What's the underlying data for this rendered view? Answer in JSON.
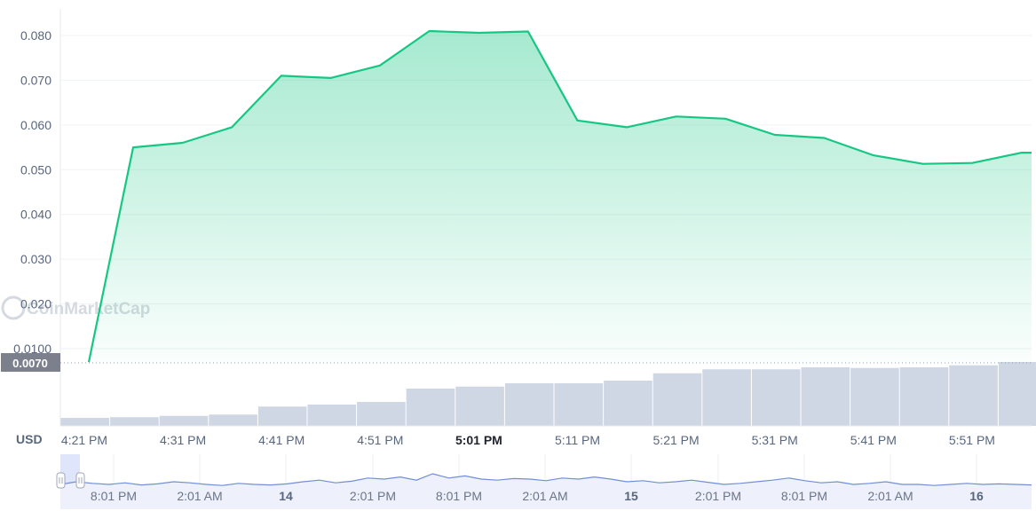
{
  "watermark": "CoinMarketCap",
  "currency_label": "USD",
  "current_price_label": "0.0070",
  "colors": {
    "line": "#16c784",
    "area_top": "#16c784",
    "volume_bar": "#cfd6e4",
    "navigator_line": "#6f8fd8",
    "navigator_fill": "#eef1fc",
    "price_badge": "#7c808c",
    "axis_text": "#58667e",
    "grid": "#eff2f5"
  },
  "chart_data": {
    "type": "area",
    "ylim": [
      0,
      0.085
    ],
    "y_ticks": [
      "0.0100",
      "0.020",
      "0.030",
      "0.040",
      "0.050",
      "0.060",
      "0.070",
      "0.080"
    ],
    "x_ticks": [
      "4:21 PM",
      "4:31 PM",
      "4:41 PM",
      "4:51 PM",
      "5:01 PM",
      "5:11 PM",
      "5:21 PM",
      "5:31 PM",
      "5:41 PM",
      "5:51 PM"
    ],
    "x_ticks_bold": [
      "5:01 PM"
    ],
    "series": [
      {
        "x_minutes_from_421pm": [
          0.5,
          5,
          10,
          15,
          20,
          25,
          30,
          35,
          40,
          45,
          50,
          55,
          60,
          65,
          70,
          75,
          80,
          85,
          90,
          95,
          100
        ],
        "values": [
          0.007,
          0.055,
          0.056,
          0.0595,
          0.071,
          0.0705,
          0.0733,
          0.081,
          0.0806,
          0.0809,
          0.061,
          0.0595,
          0.0619,
          0.0614,
          0.0578,
          0.0571,
          0.0532,
          0.0513,
          0.0515,
          0.0538,
          0.0538
        ]
      }
    ],
    "volume": [
      0.12,
      0.13,
      0.15,
      0.17,
      0.29,
      0.32,
      0.36,
      0.56,
      0.59,
      0.64,
      0.64,
      0.68,
      0.79,
      0.85,
      0.85,
      0.88,
      0.87,
      0.88,
      0.91,
      0.96
    ],
    "navigator": {
      "x_ticks": [
        "8:01 PM",
        "2:01 AM",
        "14",
        "2:01 PM",
        "8:01 PM",
        "2:01 AM",
        "15",
        "2:01 PM",
        "8:01 PM",
        "2:01 AM",
        "16"
      ],
      "x_ticks_bold": [
        "14",
        "15",
        "16"
      ],
      "values": [
        0.5,
        0.55,
        0.52,
        0.5,
        0.53,
        0.49,
        0.51,
        0.55,
        0.53,
        0.5,
        0.48,
        0.52,
        0.5,
        0.49,
        0.51,
        0.55,
        0.58,
        0.53,
        0.56,
        0.62,
        0.6,
        0.64,
        0.58,
        0.7,
        0.62,
        0.66,
        0.6,
        0.58,
        0.61,
        0.6,
        0.57,
        0.62,
        0.6,
        0.64,
        0.6,
        0.55,
        0.57,
        0.53,
        0.55,
        0.58,
        0.54,
        0.5,
        0.52,
        0.55,
        0.58,
        0.62,
        0.57,
        0.53,
        0.55,
        0.5,
        0.52,
        0.55,
        0.5,
        0.5,
        0.48,
        0.5,
        0.52,
        0.5,
        0.51,
        0.5,
        0.49
      ]
    }
  }
}
